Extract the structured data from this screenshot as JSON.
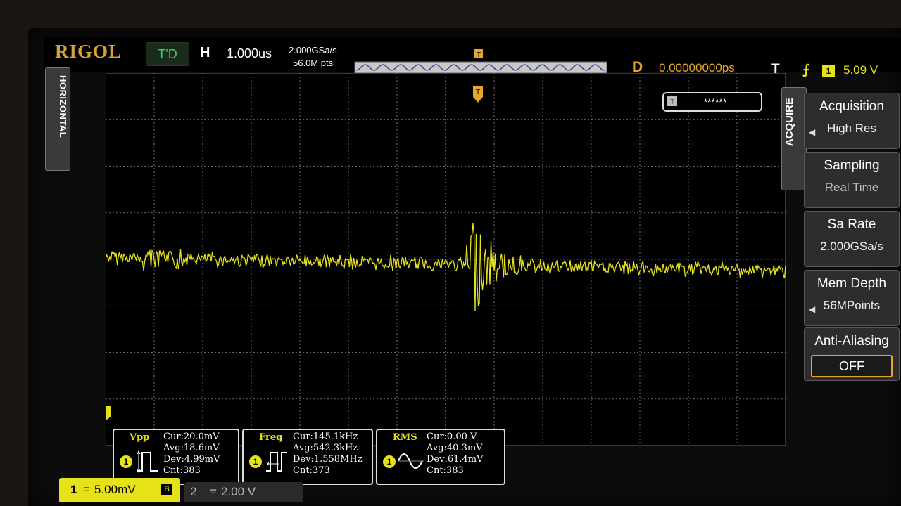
{
  "colors": {
    "ch1": "#e6e21a",
    "trigger": "#e8a62a",
    "grid": "#8a8a8a",
    "background": "#000000"
  },
  "header": {
    "logo": "RIGOL",
    "run_state": "T'D",
    "horizontal_label": "H",
    "timebase": "1.000us",
    "sample_rate": "2.000GSa/s",
    "mem_points": "56.0M pts",
    "delay_label": "D",
    "delay_value": "0.00000000ps",
    "trigger_label": "T",
    "trigger_source": "1",
    "trigger_level": "5.09 V"
  },
  "left_tab": {
    "label": "HORIZONTAL"
  },
  "screen": {
    "trigger_status": "******",
    "trigger_marker": "T",
    "channel_marker": "1"
  },
  "menu": {
    "tab": "ACQUIRE",
    "items": [
      {
        "label": "Acquisition",
        "value": "High Res"
      },
      {
        "label": "Sampling",
        "value": "Real Time"
      },
      {
        "label": "Sa Rate",
        "value": "2.000GSa/s"
      },
      {
        "label": "Mem Depth",
        "value": "56MPoints"
      },
      {
        "label": "Anti-Aliasing",
        "value": "OFF"
      }
    ]
  },
  "measurements": [
    {
      "name": "Vpp",
      "channel": "1",
      "cur": "Cur:20.0mV",
      "avg": "Avg:18.6mV",
      "dev": "Dev:4.99mV",
      "cnt": "Cnt:383"
    },
    {
      "name": "Freq",
      "channel": "1",
      "cur": "Cur:145.1kHz",
      "avg": "Avg:542.3kHz",
      "dev": "Dev:1.558MHz",
      "cnt": "Cnt:373"
    },
    {
      "name": "RMS",
      "channel": "1",
      "cur": "Cur:0.00 V",
      "avg": "Avg:40.3mV",
      "dev": "Dev:61.4mV",
      "cnt": "Cnt:383"
    }
  ],
  "channels": [
    {
      "num": "1",
      "coupling": "=",
      "scale": "5.00mV"
    },
    {
      "num": "2",
      "coupling": "=",
      "scale": "2.00 V"
    }
  ],
  "grid": {
    "h_divisions": 14,
    "v_divisions": 8
  }
}
